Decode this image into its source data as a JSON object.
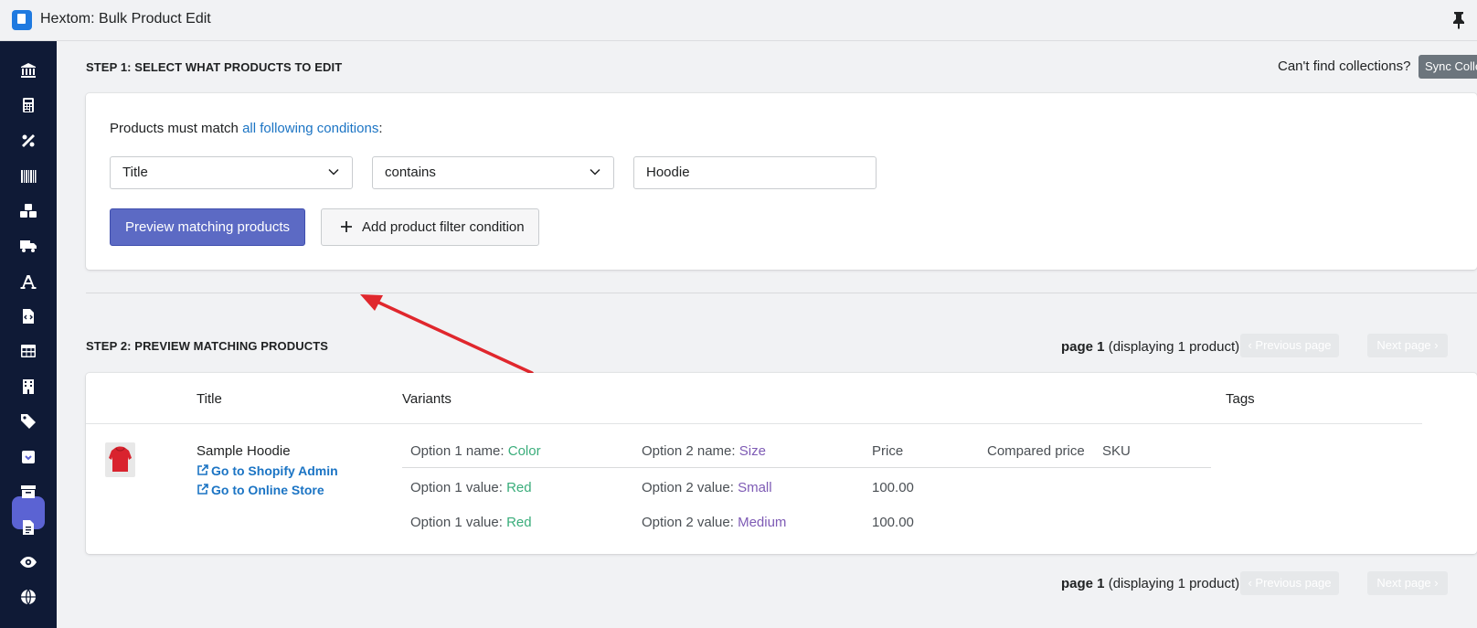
{
  "app": {
    "title": "Hextom: Bulk Product Edit"
  },
  "sidebar": {
    "items": [
      {
        "icon": "bank-icon"
      },
      {
        "icon": "calculator-icon"
      },
      {
        "icon": "percent-icon"
      },
      {
        "icon": "barcode-icon"
      },
      {
        "icon": "boxes-icon"
      },
      {
        "icon": "truck-icon"
      },
      {
        "icon": "font-icon"
      },
      {
        "icon": "file-code-icon"
      },
      {
        "icon": "table-icon"
      },
      {
        "icon": "building-icon"
      },
      {
        "icon": "tag-icon"
      },
      {
        "icon": "box-archive-active-icon"
      },
      {
        "icon": "archive-icon"
      },
      {
        "icon": "file-alt-icon"
      },
      {
        "icon": "eye-icon"
      },
      {
        "icon": "globe-icon"
      }
    ]
  },
  "step1": {
    "title": "STEP 1: SELECT WHAT PRODUCTS TO EDIT",
    "cant_find": "Can't find collections?",
    "sync_label": "Sync Collections",
    "match_prefix": "Products must match ",
    "match_link": "all following conditions",
    "match_suffix": ":",
    "field_select": "Title",
    "operator_select": "contains",
    "value_input": "Hoodie",
    "preview_label": "Preview matching products",
    "add_filter_label": "Add product filter condition"
  },
  "step2": {
    "title": "STEP 2: PREVIEW MATCHING PRODUCTS",
    "pager": {
      "page_label": "page 1",
      "displaying": "(displaying 1 product)",
      "prev_label": "Previous page",
      "next_label": "Next page"
    },
    "headers": {
      "title": "Title",
      "variants": "Variants",
      "tags": "Tags"
    },
    "product": {
      "title": "Sample Hoodie",
      "admin_link": "Go to Shopify Admin",
      "store_link": "Go to Online Store",
      "variant_header": {
        "option1_label": "Option 1 name: ",
        "option1_name": "Color",
        "option2_label": "Option 2 name: ",
        "option2_name": "Size",
        "price": "Price",
        "compared_price": "Compared price",
        "sku": "SKU"
      },
      "variants": [
        {
          "opt1_label": "Option 1 value: ",
          "opt1": "Red",
          "opt2_label": "Option 2 value: ",
          "opt2": "Small",
          "price": "100.00"
        },
        {
          "opt1_label": "Option 1 value: ",
          "opt1": "Red",
          "opt2_label": "Option 2 value: ",
          "opt2": "Medium",
          "price": "100.00"
        }
      ]
    }
  },
  "colors": {
    "primary": "#5c6ac4",
    "link": "#1b74c4",
    "sidebar": "#0f1a36",
    "green_value": "#3aad7b",
    "purple_value": "#7e5bb5",
    "arrow": "#e0272d"
  }
}
